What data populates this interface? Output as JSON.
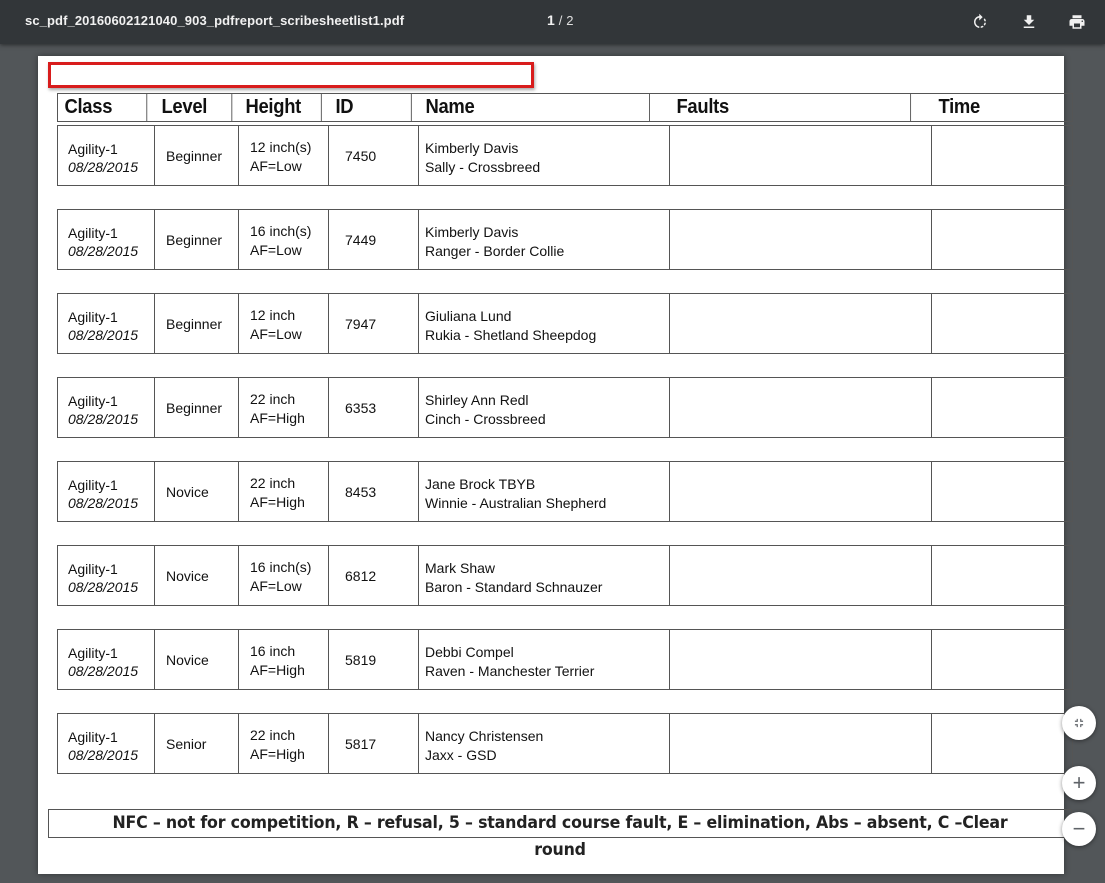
{
  "toolbar": {
    "filename": "sc_pdf_20160602121040_903_pdfreport_scribesheetlist1.pdf",
    "current_page": "1",
    "separator": "/",
    "total_pages": "2",
    "icons": [
      "rotate-icon",
      "download-icon",
      "print-icon"
    ]
  },
  "table": {
    "headers": {
      "class": "Class",
      "level": "Level",
      "height": "Height",
      "id": "ID",
      "name": "Name",
      "faults": "Faults",
      "time": "Time"
    },
    "rows": [
      {
        "class": "Agility-1",
        "date": "08/28/2015",
        "level": "Beginner",
        "height": "12 inch(s)",
        "af": "AF=Low",
        "id": "7450",
        "handler": "Kimberly Davis",
        "dog": "Sally - Crossbreed",
        "faults": "",
        "time": ""
      },
      {
        "class": "Agility-1",
        "date": "08/28/2015",
        "level": "Beginner",
        "height": "16 inch(s)",
        "af": "AF=Low",
        "id": "7449",
        "handler": "Kimberly Davis",
        "dog": "Ranger - Border Collie",
        "faults": "",
        "time": ""
      },
      {
        "class": "Agility-1",
        "date": "08/28/2015",
        "level": "Beginner",
        "height": "12 inch",
        "af": "AF=Low",
        "id": "7947",
        "handler": "Giuliana Lund",
        "dog": "Rukia - Shetland Sheepdog",
        "faults": "",
        "time": ""
      },
      {
        "class": "Agility-1",
        "date": "08/28/2015",
        "level": "Beginner",
        "height": "22 inch",
        "af": "AF=High",
        "id": "6353",
        "handler": "Shirley Ann Redl",
        "dog": "Cinch - Crossbreed",
        "faults": "",
        "time": ""
      },
      {
        "class": "Agility-1",
        "date": "08/28/2015",
        "level": "Novice",
        "height": "22 inch",
        "af": "AF=High",
        "id": "8453",
        "handler": "Jane Brock TBYB",
        "dog": "Winnie - Australian Shepherd",
        "faults": "",
        "time": ""
      },
      {
        "class": "Agility-1",
        "date": "08/28/2015",
        "level": "Novice",
        "height": "16 inch(s)",
        "af": "AF=Low",
        "id": "6812",
        "handler": "Mark Shaw",
        "dog": "Baron - Standard Schnauzer",
        "faults": "",
        "time": ""
      },
      {
        "class": "Agility-1",
        "date": "08/28/2015",
        "level": "Novice",
        "height": "16 inch",
        "af": "AF=High",
        "id": "5819",
        "handler": "Debbi Compel",
        "dog": "Raven - Manchester Terrier",
        "faults": "",
        "time": ""
      },
      {
        "class": "Agility-1",
        "date": "08/28/2015",
        "level": "Senior",
        "height": "22 inch",
        "af": "AF=High",
        "id": "5817",
        "handler": "Nancy Christensen",
        "dog": "Jaxx - GSD",
        "faults": "",
        "time": ""
      }
    ]
  },
  "legend": "NFC – not for competition, R – refusal, 5 – standard course fault, E – elimination, Abs – absent, C –Clear round",
  "controls": {
    "fit_icon": "fit-to-page-icon",
    "zoom_in": "+",
    "zoom_out": "−"
  },
  "colors": {
    "toolbar_bg": "#323639",
    "viewer_bg": "#525659",
    "highlight_box": "#d81c1c"
  }
}
